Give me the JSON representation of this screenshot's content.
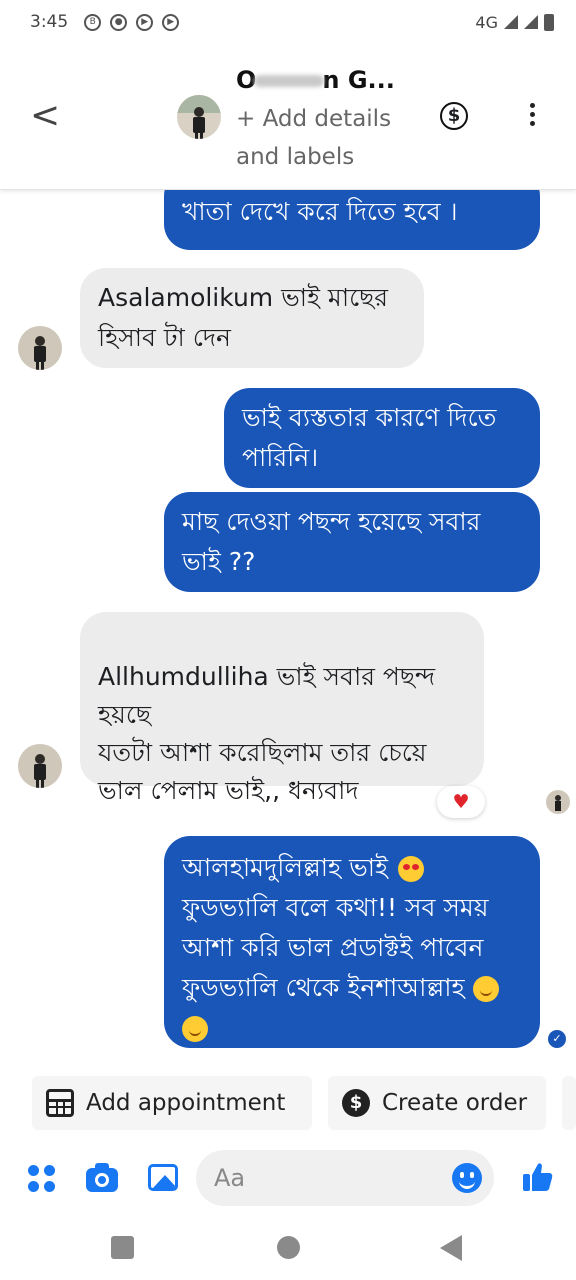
{
  "status_bar": {
    "time": "3:45",
    "icons": [
      "b-icon",
      "chat-icon",
      "media-icon",
      "media-icon-2"
    ],
    "network": "4G"
  },
  "header": {
    "contact_name_prefix": "O",
    "contact_name_suffix": "n G...",
    "add_details": "+ Add details and labels",
    "dollar_symbol": "$"
  },
  "messages": [
    {
      "direction": "out",
      "text": "খাতা দেখে করে দিতে হবে ।"
    },
    {
      "direction": "in",
      "text": "Asalamolikum ভাই মাছের হিসাব টা দেন"
    },
    {
      "direction": "out",
      "text": "ভাই ব্যস্ততার কারণে দিতে পারিনি।"
    },
    {
      "direction": "out",
      "text": "মাছ দেওয়া পছন্দ হয়েছে সবার ভাই ??"
    },
    {
      "direction": "in",
      "text": "Allhumdulliha ভাই সবার পছন্দ হয়ছে\nযতটা আশা করেছিলাম তার চেয়ে ভাল পেলাম ভাই,, ধন্যবাদ",
      "reaction": "♥"
    },
    {
      "direction": "out",
      "text_main": "আলহামদুলিল্লাহ ভাই",
      "text_rest": "ফুডভ্যালি বলে কথা!! সব সময় আশা করি ভাল প্রডাক্টই পাবেন ফুডভ্যালি থেকে ইনশাআল্লাহ",
      "delivered_mark": "✓"
    }
  ],
  "quick_actions": {
    "appointment": "Add appointment",
    "order": "Create order",
    "order_symbol": "$"
  },
  "composer": {
    "placeholder": "Aa"
  },
  "colors": {
    "outgoing_bubble": "#1a56b8",
    "incoming_bubble": "#ececec",
    "accent": "#1877f2"
  }
}
